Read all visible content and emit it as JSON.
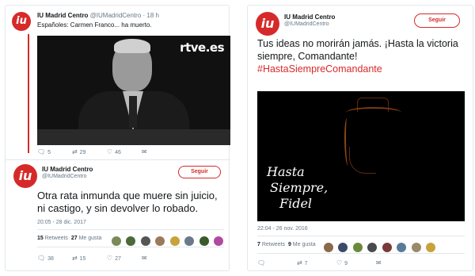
{
  "left_panel": {
    "tweet1": {
      "avatar_label": "iu",
      "name": "IU Madrid Centro",
      "handle": "@IUMadridCentro",
      "time": "· 18 h",
      "text": "Españoles: Carmen Franco... ha muerto.",
      "video_logo": "rtve.es",
      "replies": "5",
      "retweets": "29",
      "likes": "46"
    },
    "tweet2": {
      "avatar_label": "iu",
      "name": "IU Madrid Centro",
      "handle": "@IUMadridCentro",
      "follow_label": "Seguir",
      "text_line1": "Otra rata inmunda que muere sin juicio,",
      "text_line2": "ni castigo, y sin devolver lo robado.",
      "timestamp": "20:05 - 28 dic. 2017",
      "retweets_count": "15",
      "retweets_label": "Retweets",
      "likes_count": "27",
      "likes_label": "Me gusta",
      "replies": "38",
      "retweets": "15",
      "likes": "27"
    }
  },
  "right_panel": {
    "avatar_label": "iu",
    "name": "IU Madrid Centro",
    "handle": "@IUMadridCentro",
    "follow_label": "Seguir",
    "text_line1": "Tus ideas no morirán jamás. ¡Hasta la victoria",
    "text_line2": "siempre, Comandante!",
    "hashtag": "#HastaSiempreComandante",
    "photo_script_line1": "Hasta",
    "photo_script_line2": "Siempre,",
    "photo_script_line3": "Fidel",
    "timestamp": "22:04 - 26 nov. 2016",
    "retweets_count": "7",
    "retweets_label": "Retweets",
    "likes_count": "9",
    "likes_label": "Me gusta",
    "retweets": "7",
    "likes": "9"
  },
  "colors": {
    "brand": "#d62a2a",
    "muted": "#657786",
    "border": "#e1e8ed",
    "hashtag": "#d62a2a"
  },
  "icons": {
    "reply": "reply-icon",
    "retweet": "retweet-icon",
    "like": "heart-icon",
    "dm": "envelope-icon"
  }
}
